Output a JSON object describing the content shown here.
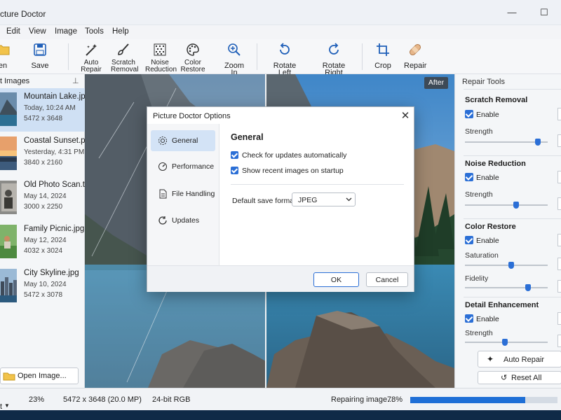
{
  "window": {
    "title": "cture Doctor",
    "minimize_icon": "minimize-icon",
    "maximize_icon": "maximize-icon"
  },
  "menu": [
    "Edit",
    "View",
    "Image",
    "Tools",
    "Help"
  ],
  "toolbar": {
    "open": "en",
    "save": "Save",
    "auto_repair": [
      "Auto",
      "Repair"
    ],
    "scratch_removal": [
      "Scratch",
      "Removal"
    ],
    "noise_reduction": [
      "Noise",
      "Reduction"
    ],
    "color_restore": [
      "Color",
      "Restore"
    ],
    "zoom_in": "Zoom In",
    "rotate_left": "Rotate Left",
    "rotate_right": "Rotate Right",
    "crop": "Crop",
    "repair": "Repair"
  },
  "recent": {
    "title": "t Images",
    "items": [
      {
        "name": "Mountain Lake.jpg",
        "date": "Today, 10:24 AM",
        "size": "5472 x 3648"
      },
      {
        "name": "Coastal Sunset.png",
        "date": "Yesterday, 4:31 PM",
        "size": "3840 x 2160"
      },
      {
        "name": "Old Photo Scan.tif",
        "date": "May 14, 2024",
        "size": "3000 x 2250"
      },
      {
        "name": "Family Picnic.jpg",
        "date": "May 12, 2024",
        "size": "4032 x 3024"
      },
      {
        "name": "City Skyline.jpg",
        "date": "May 10, 2024",
        "size": "5472 x 3078"
      }
    ],
    "open_button": "Open Image..."
  },
  "canvas": {
    "after_label": "After"
  },
  "repair_tools": {
    "title": "Repair Tools",
    "scratch": {
      "title": "Scratch Removal",
      "enable": "Enable",
      "strength_label": "Strength",
      "strength": 0.88
    },
    "noise": {
      "title": "Noise Reduction",
      "enable": "Enable",
      "strength_label": "Strength",
      "strength": 0.62
    },
    "color": {
      "title": "Color Restore",
      "enable": "Enable",
      "saturation_label": "Saturation",
      "saturation": 0.56,
      "fidelity_label": "Fidelity",
      "fidelity": 0.76
    },
    "detail": {
      "title": "Detail Enhancement",
      "enable": "Enable",
      "strength_label": "Strength",
      "strength": 0.48
    },
    "auto_repair_button": "Auto Repair",
    "reset_all_button": "Reset All"
  },
  "status": {
    "view_mode": "t",
    "zoom": "23%",
    "dimensions": "5472 x 3648 (20.0 MP)",
    "color_depth": "24-bit RGB",
    "progress_text": "Repairing image...",
    "progress_percent": "78%",
    "progress": 0.78
  },
  "dialog": {
    "title": "Picture Doctor Options",
    "nav": [
      "General",
      "Performance",
      "File Handling",
      "Updates"
    ],
    "heading": "General",
    "check_updates": "Check for updates automatically",
    "show_recent": "Show recent images on startup",
    "save_format_label": "Default save format:",
    "save_format_value": "JPEG",
    "ok": "OK",
    "cancel": "Cancel"
  }
}
